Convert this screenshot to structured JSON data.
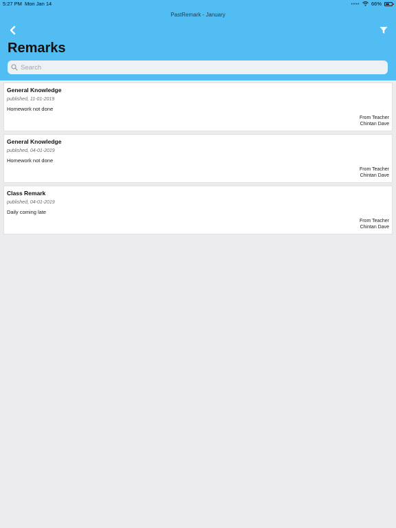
{
  "status_bar": {
    "time": "5:27 PM",
    "date": "Mon Jan 14",
    "battery": "66%",
    "battery_level": 0.66
  },
  "header": {
    "nav_title": "PastRemark - January",
    "title": "Remarks",
    "back_icon": "chevron-left-icon",
    "filter_icon": "filter-icon",
    "background_color": "#52bdf2"
  },
  "search": {
    "placeholder": "Search",
    "value": ""
  },
  "remarks": [
    {
      "title": "General Knowledge",
      "published": "published, 11-01-2019",
      "body": "Homework not done",
      "from_label": "From Teacher",
      "teacher": "Chintan Dave"
    },
    {
      "title": "General Knowledge",
      "published": "published, 04-01-2019",
      "body": "Homework not done",
      "from_label": "From Teacher",
      "teacher": "Chintan Dave"
    },
    {
      "title": "Class Remark",
      "published": "published, 04-01-2019",
      "body": "Daily coming late",
      "from_label": "From Teacher",
      "teacher": "Chintan Dave"
    }
  ]
}
